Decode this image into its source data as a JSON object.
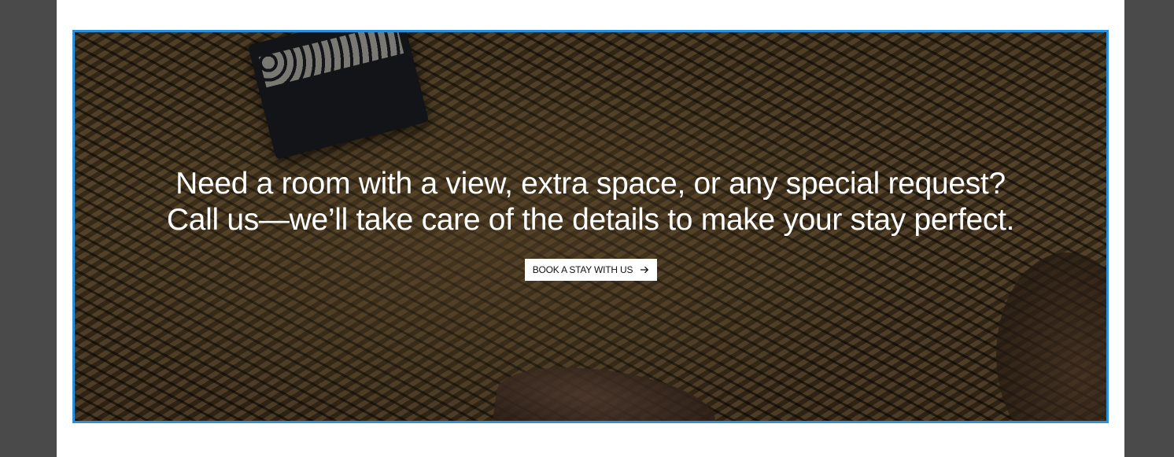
{
  "hero": {
    "headline_line1": "Need a room with a view, extra space, or any special request?",
    "headline_line2": "Call us—we’ll take care of the details to make your stay perfect.",
    "cta_label": "BOOK A STAY WITH US",
    "cta_icon": "arrow-right-icon"
  },
  "colors": {
    "page_background": "#4a4a4a",
    "content_background": "#ffffff",
    "selection_outline": "#2a8fdc",
    "cta_background": "#ffffff",
    "cta_text": "#111111",
    "headline_text": "#ffffff"
  }
}
